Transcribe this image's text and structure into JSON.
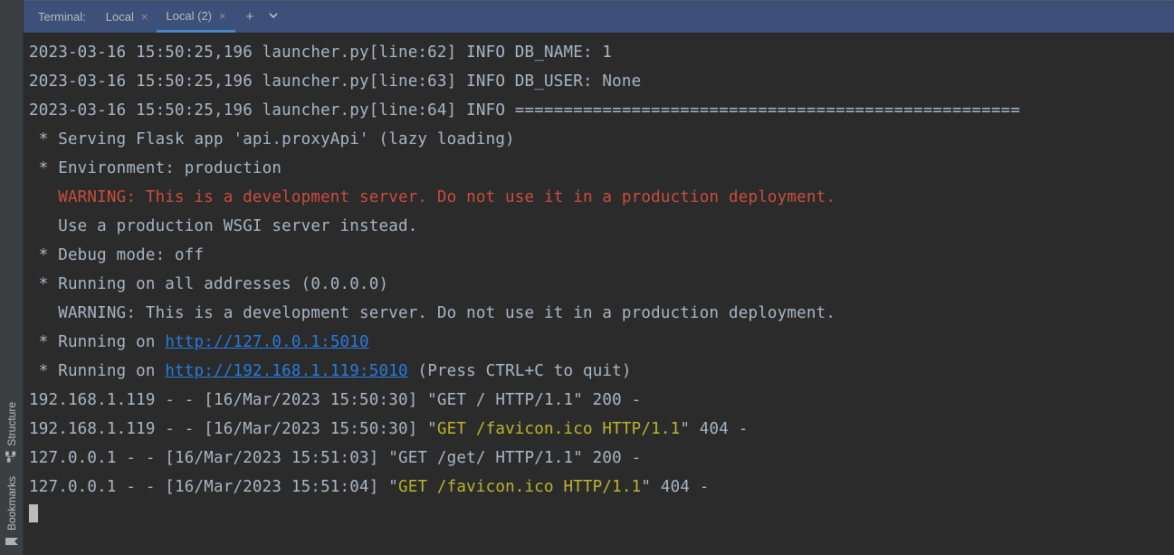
{
  "sidebar": {
    "structure": "Structure",
    "bookmarks": "Bookmarks"
  },
  "tabbar": {
    "label": "Terminal:",
    "tabs": [
      {
        "name": "Local",
        "active": false
      },
      {
        "name": "Local (2)",
        "active": true
      }
    ]
  },
  "terminal": {
    "lines": [
      {
        "segs": [
          {
            "t": "2023-03-16 15:50:25,196 launcher.py[line:62] INFO DB_NAME: 1"
          }
        ]
      },
      {
        "segs": [
          {
            "t": "2023-03-16 15:50:25,196 launcher.py[line:63] INFO DB_USER: None"
          }
        ]
      },
      {
        "segs": [
          {
            "t": "2023-03-16 15:50:25,196 launcher.py[line:64] INFO ===================================================="
          }
        ]
      },
      {
        "segs": [
          {
            "t": " * Serving Flask app 'api.proxyApi' (lazy loading)"
          }
        ]
      },
      {
        "segs": [
          {
            "t": " * Environment: production"
          }
        ]
      },
      {
        "segs": [
          {
            "t": "   WARNING: This is a development server. Do not use it in a production deployment.",
            "cls": "warn"
          }
        ]
      },
      {
        "segs": [
          {
            "t": "   Use a production WSGI server instead."
          }
        ]
      },
      {
        "segs": [
          {
            "t": " * Debug mode: off"
          }
        ]
      },
      {
        "segs": [
          {
            "t": " * Running on all addresses (0.0.0.0)"
          }
        ]
      },
      {
        "segs": [
          {
            "t": "   WARNING: This is a development server. Do not use it in a production deployment."
          }
        ]
      },
      {
        "segs": [
          {
            "t": " * Running on "
          },
          {
            "t": "http://127.0.0.1:5010",
            "cls": "link"
          }
        ]
      },
      {
        "segs": [
          {
            "t": " * Running on "
          },
          {
            "t": "http://192.168.1.119:5010",
            "cls": "link"
          },
          {
            "t": " (Press CTRL+C to quit)"
          }
        ]
      },
      {
        "segs": [
          {
            "t": "192.168.1.119 - - [16/Mar/2023 15:50:30] \"GET / HTTP/1.1\" 200 -"
          }
        ]
      },
      {
        "segs": [
          {
            "t": "192.168.1.119 - - [16/Mar/2023 15:50:30] \""
          },
          {
            "t": "GET /favicon.ico HTTP/1.1",
            "cls": "yellow"
          },
          {
            "t": "\" 404 -"
          }
        ]
      },
      {
        "segs": [
          {
            "t": "127.0.0.1 - - [16/Mar/2023 15:51:03] \"GET /get/ HTTP/1.1\" 200 -"
          }
        ]
      },
      {
        "segs": [
          {
            "t": "127.0.0.1 - - [16/Mar/2023 15:51:04] \""
          },
          {
            "t": "GET /favicon.ico HTTP/1.1",
            "cls": "yellow"
          },
          {
            "t": "\" 404 -"
          }
        ]
      }
    ]
  }
}
